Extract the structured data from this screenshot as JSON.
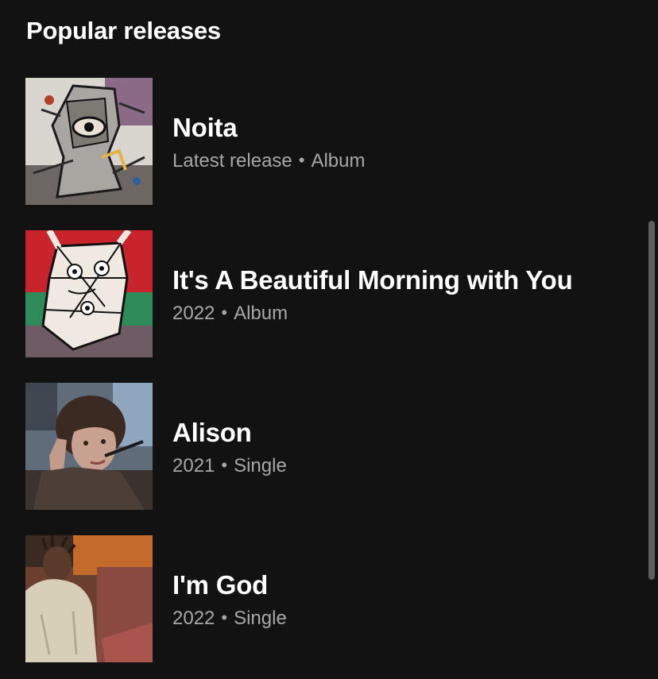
{
  "section": {
    "title": "Popular releases"
  },
  "releases": [
    {
      "title": "Noita",
      "year": "Latest release",
      "type": "Album",
      "separator": "•"
    },
    {
      "title": "It's A Beautiful Morning with You",
      "year": "2022",
      "type": "Album",
      "separator": "•"
    },
    {
      "title": "Alison",
      "year": "2021",
      "type": "Single",
      "separator": "•"
    },
    {
      "title": "I'm God",
      "year": "2022",
      "type": "Single",
      "separator": "•"
    }
  ],
  "colors": {
    "background": "#121212",
    "title_text": "#ffffff",
    "meta_text": "#a7a7a7",
    "scrollbar": "#5e5e5e"
  }
}
